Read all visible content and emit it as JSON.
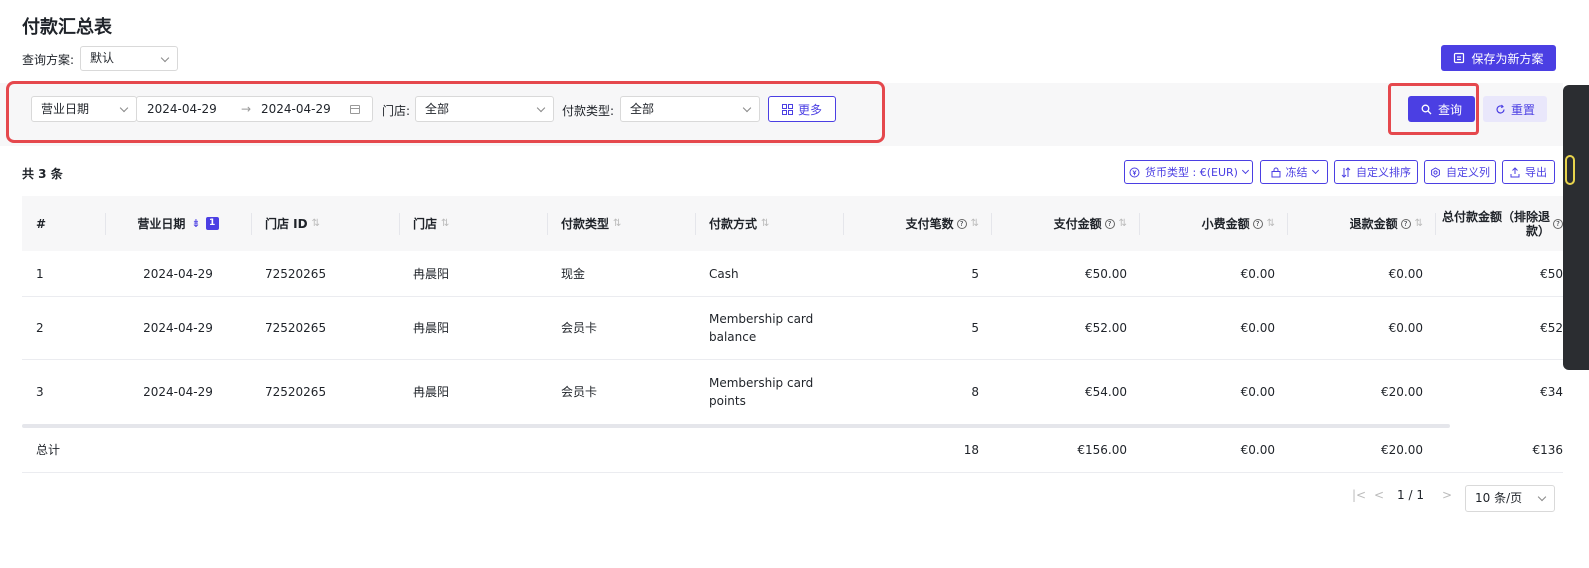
{
  "page_title": "付款汇总表",
  "plan": {
    "label": "查询方案:",
    "value": "默认"
  },
  "save_button": "保存为新方案",
  "filters": {
    "date_type": "营业日期",
    "date_start": "2024-04-29",
    "date_arrow": "→",
    "date_end": "2024-04-29",
    "store_label": "门店:",
    "store_value": "全部",
    "payment_type_label": "付款类型:",
    "payment_type_value": "全部",
    "more_label": "更多"
  },
  "actions": {
    "query": "查询",
    "reset": "重置"
  },
  "count_text": "共 3 条",
  "toolbar": {
    "currency": "货币类型 : €(EUR)",
    "freeze": "冻结",
    "custom_sort": "自定义排序",
    "custom_columns": "自定义列",
    "export": "导出"
  },
  "columns": [
    {
      "label": "#"
    },
    {
      "label": "营业日期",
      "badge": "1"
    },
    {
      "label": "门店 ID"
    },
    {
      "label": "门店"
    },
    {
      "label": "付款类型"
    },
    {
      "label": "付款方式"
    },
    {
      "label": "支付笔数"
    },
    {
      "label": "支付金额"
    },
    {
      "label": "小费金额"
    },
    {
      "label": "退款金额"
    },
    {
      "label": "总付款金额（排除退款）"
    }
  ],
  "rows": [
    [
      "1",
      "2024-04-29",
      "72520265",
      "冉晨阳",
      "现金",
      "Cash",
      "5",
      "€50.00",
      "€0.00",
      "€0.00",
      "€50"
    ],
    [
      "2",
      "2024-04-29",
      "72520265",
      "冉晨阳",
      "会员卡",
      "Membership card balance",
      "5",
      "€52.00",
      "€0.00",
      "€0.00",
      "€52"
    ],
    [
      "3",
      "2024-04-29",
      "72520265",
      "冉晨阳",
      "会员卡",
      "Membership card points",
      "8",
      "€54.00",
      "€0.00",
      "€20.00",
      "€34"
    ]
  ],
  "totals": [
    "总计",
    "18",
    "€156.00",
    "€0.00",
    "€20.00",
    "€136"
  ],
  "pagination": {
    "current": "1",
    "separator": "/",
    "total": "1",
    "page_size": "10 条/页"
  },
  "colors": {
    "primary": "#4b3fe3",
    "highlight": "#e5484d"
  }
}
